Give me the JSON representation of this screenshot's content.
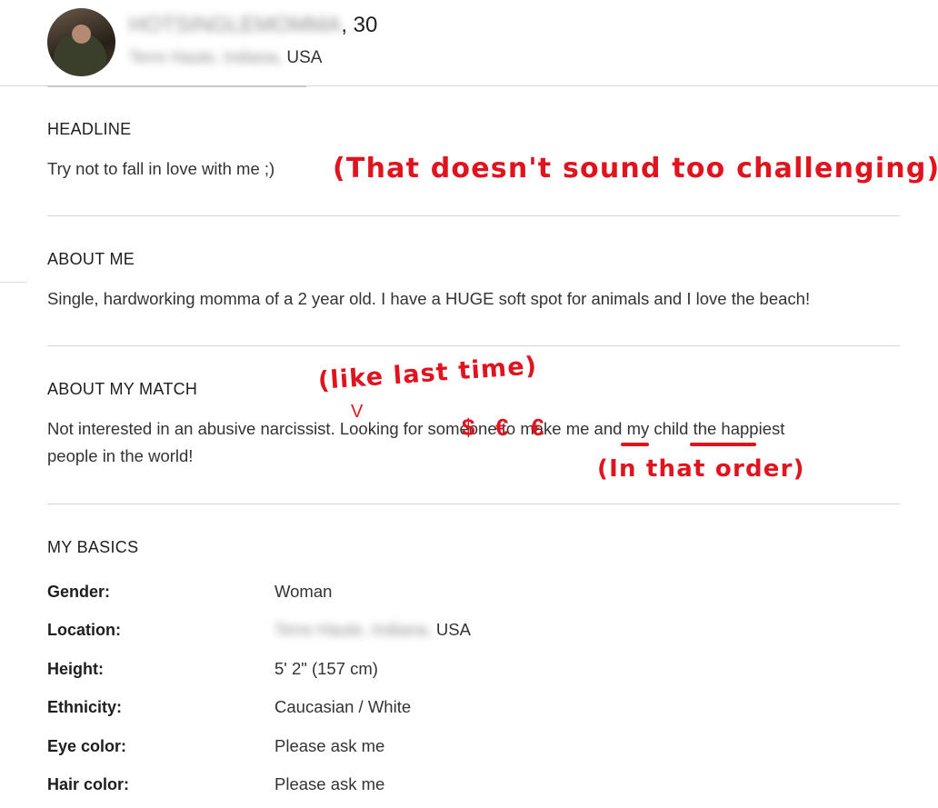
{
  "profile": {
    "username": "HOTSINGLEMOMMA",
    "age_suffix": ", 30",
    "city": "Terre Haute, Indiana,",
    "country": "USA"
  },
  "sections": {
    "headline": {
      "title": "HEADLINE",
      "text": "Try not to fall in love with me ;)"
    },
    "about_me": {
      "title": "ABOUT ME",
      "text": "Single, hardworking momma of a 2 year old. I have a HUGE soft spot for animals and I love the beach!"
    },
    "about_my_match": {
      "title": "ABOUT MY MATCH",
      "line1_a": "Not interested in an abusive narcissist. Looking for someone to make ",
      "line1_me": "me",
      "line1_and": " and ",
      "line1_child": "my child",
      "line1_end": " the happiest",
      "line2": "people in the world!"
    },
    "my_basics": {
      "title": "MY BASICS",
      "rows": [
        {
          "label": "Gender:",
          "value": "Woman"
        },
        {
          "label": "Location:",
          "value_blur": "Terre Haute, Indiana,",
          "value": "USA"
        },
        {
          "label": "Height:",
          "value": "5' 2\" (157 cm)"
        },
        {
          "label": "Ethnicity:",
          "value": "Caucasian / White"
        },
        {
          "label": "Eye color:",
          "value": "Please ask me"
        },
        {
          "label": "Hair color:",
          "value": "Please ask me"
        }
      ]
    }
  },
  "annotations": {
    "headline_comment": "(That doesn't sound too challenging)",
    "narcissist_comment": "(like last time)",
    "order_comment": "(In that order)",
    "caret": "V",
    "money_1": "$",
    "money_2": "€",
    "money_3": "€",
    "annotation_color": "#e0141e"
  }
}
